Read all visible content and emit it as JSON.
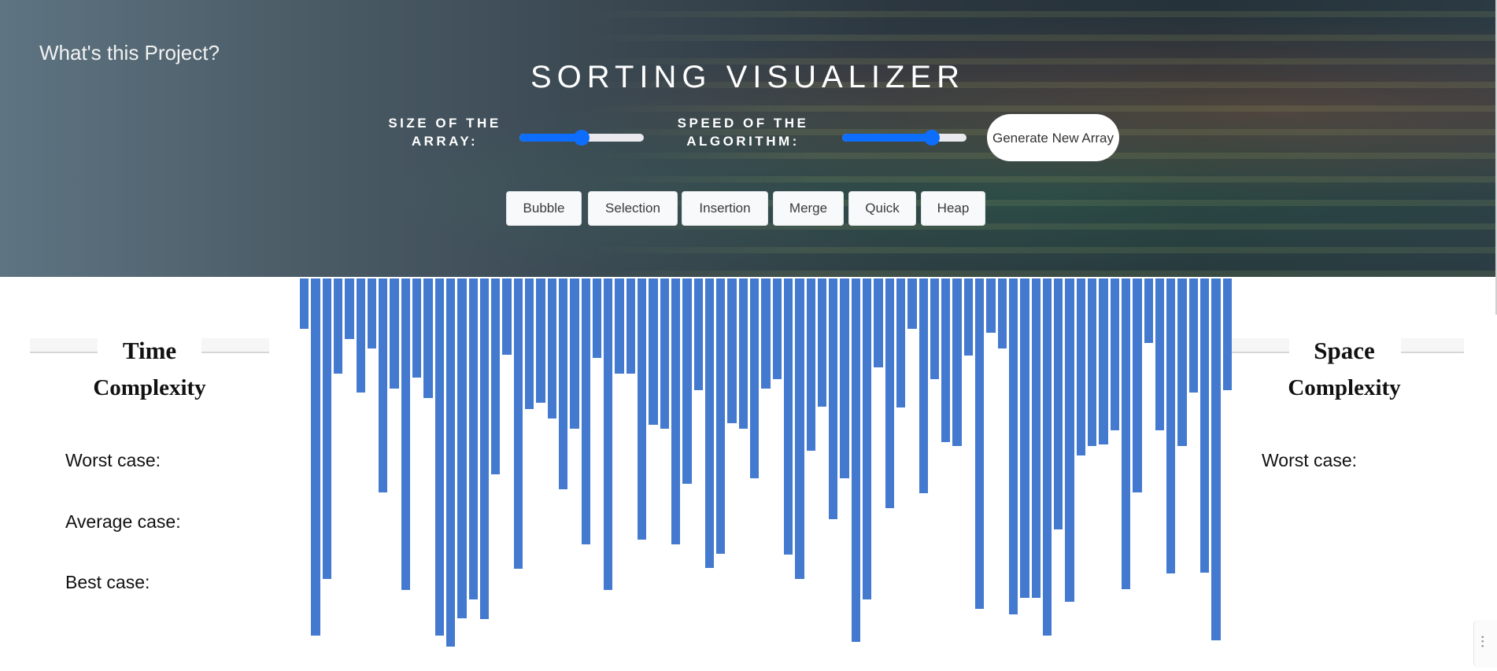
{
  "header": {
    "about_link": "What's this Project?",
    "title": "SORTING VISUALIZER",
    "size_label": "SIZE OF THE ARRAY:",
    "speed_label": "SPEED OF THE ALGORITHM:",
    "size_slider_value": 0.5,
    "speed_slider_value": 0.72,
    "generate_button": "Generate New Array",
    "accent_color": "#0d6efd"
  },
  "algorithms": [
    {
      "label": "Bubble"
    },
    {
      "label": "Selection"
    },
    {
      "label": "Insertion"
    },
    {
      "label": "Merge"
    },
    {
      "label": "Quick"
    },
    {
      "label": "Heap"
    }
  ],
  "time_complexity": {
    "title_line1": "Time",
    "title_line2": "Complexity",
    "worst": "Worst case:",
    "average": "Average case:",
    "best": "Best case:"
  },
  "space_complexity": {
    "title_line1": "Space",
    "title_line2": "Complexity",
    "worst": "Worst case:"
  },
  "chart_data": {
    "type": "bar",
    "orientation": "down",
    "bar_color": "#4479d0",
    "max_value": 470,
    "values": [
      66,
      470,
      395,
      125,
      80,
      150,
      92,
      282,
      145,
      410,
      130,
      157,
      470,
      485,
      447,
      422,
      448,
      258,
      100,
      382,
      172,
      164,
      184,
      277,
      198,
      350,
      105,
      410,
      125,
      125,
      344,
      193,
      198,
      350,
      270,
      147,
      381,
      362,
      190,
      198,
      263,
      145,
      132,
      363,
      395,
      227,
      169,
      317,
      263,
      478,
      422,
      117,
      302,
      170,
      66,
      283,
      132,
      215,
      220,
      101,
      435,
      71,
      92,
      442,
      420,
      420,
      470,
      330,
      425,
      233,
      220,
      218,
      200,
      409,
      282,
      85,
      200,
      388,
      220,
      150,
      387,
      476,
      147
    ]
  }
}
